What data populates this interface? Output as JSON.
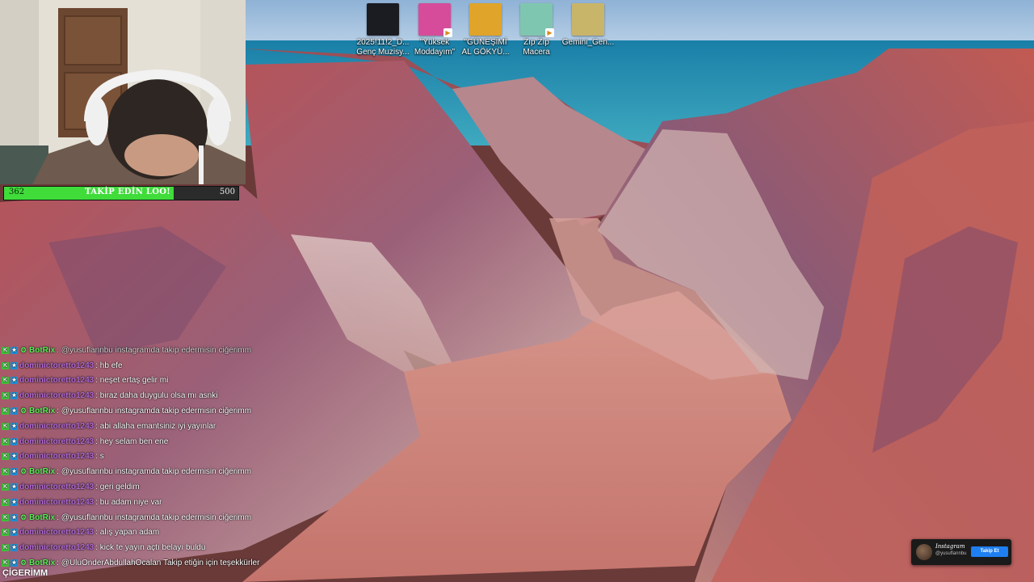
{
  "wallpaper": {
    "sky": "#9bbcdc",
    "sea": "#1e8fb0",
    "rock": "#c4605a",
    "canyon_floor": "#d98a82"
  },
  "webcam": {
    "headphone_icon": "headphones-icon"
  },
  "follow_goal": {
    "current": "362",
    "label": "TAKİP EDİN LOO!",
    "target": "500",
    "progress": 0.724,
    "fill_color": "#3fdc3a"
  },
  "desktop_icons": [
    {
      "label": "2025!11!2_D...\nGenç Muzisy...",
      "thumb": "#1b1b22",
      "video": false
    },
    {
      "label": "\"Yüksek\nModdayım\"",
      "thumb": "#d64c9a",
      "video": true
    },
    {
      "label": "\"GÜNEŞİMİ\nAL GÖKYÜ...",
      "thumb": "#e0a42a",
      "video": false
    },
    {
      "label": "Zıp Zıp\nMacera",
      "thumb": "#7fc6b0",
      "video": true
    },
    {
      "label": "Gemini_Gen...",
      "thumb": "#c9b56a",
      "video": false
    }
  ],
  "chat": [
    {
      "badges": [
        "k",
        "p",
        "bot"
      ],
      "user": "BotRix",
      "msg": ": @yusuflannbu instagramda takip edermisin ciğerimm",
      "type": "bot",
      "faded": true
    },
    {
      "badges": [
        "k",
        "p"
      ],
      "user": "dominictoretto1243",
      "msg": ": hb efe",
      "type": "dom"
    },
    {
      "badges": [
        "k",
        "p"
      ],
      "user": "dominictoretto1243",
      "msg": ": neşet ertaş gelir mi",
      "type": "dom"
    },
    {
      "badges": [
        "k",
        "p"
      ],
      "user": "dominictoretto1243",
      "msg": ": biraz daha duygulu olsa mı asnki",
      "type": "dom"
    },
    {
      "badges": [
        "k",
        "p",
        "bot"
      ],
      "user": "BotRix",
      "msg": ": @yusuflannbu instagramda takip edermisin ciğerimm",
      "type": "bot"
    },
    {
      "badges": [
        "k",
        "p"
      ],
      "user": "dominictoretto1243",
      "msg": ": abi allaha emantsiniz iyi yayınlar",
      "type": "dom"
    },
    {
      "badges": [
        "k",
        "p"
      ],
      "user": "dominictoretto1243",
      "msg": ": hey selam ben ene",
      "type": "dom"
    },
    {
      "badges": [
        "k",
        "p"
      ],
      "user": "dominictoretto1243",
      "msg": ": s",
      "type": "dom"
    },
    {
      "badges": [
        "k",
        "p",
        "bot"
      ],
      "user": "BotRix",
      "msg": ": @yusuflannbu instagramda takip edermisin ciğerimm",
      "type": "bot"
    },
    {
      "badges": [
        "k",
        "p"
      ],
      "user": "dominictoretto1243",
      "msg": ": geri geldim",
      "type": "dom"
    },
    {
      "badges": [
        "k",
        "p"
      ],
      "user": "dominictoretto1243",
      "msg": ": bu adam niye var",
      "type": "dom"
    },
    {
      "badges": [
        "k",
        "p",
        "bot"
      ],
      "user": "BotRix",
      "msg": ": @yusuflannbu instagramda takip edermisin ciğerimm",
      "type": "bot"
    },
    {
      "badges": [
        "k",
        "p"
      ],
      "user": "dominictoretto1243",
      "msg": ": alış yapan adam",
      "type": "dom"
    },
    {
      "badges": [
        "k",
        "p"
      ],
      "user": "dominictoretto1243",
      "msg": ": kick te yayın açtı belayı buldu",
      "type": "dom"
    },
    {
      "badges": [
        "k",
        "p",
        "bot"
      ],
      "user": "BotRix",
      "msg": ": @UluOnderAbdullahOcalan Takip etiğin için teşekkürler",
      "type": "bot"
    }
  ],
  "ticker": "ÇİGERİMM",
  "instagram_card": {
    "title": "Instagram",
    "handle": "@yusuflannbu",
    "button": "Takip Et"
  }
}
